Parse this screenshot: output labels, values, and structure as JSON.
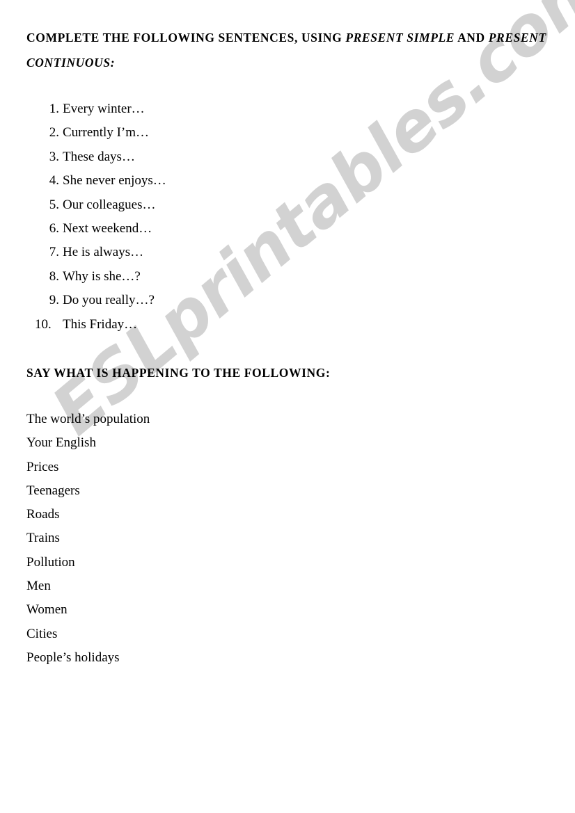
{
  "document": {
    "background_color": "#ffffff",
    "text_color": "#000000"
  },
  "headings": {
    "one": {
      "part_1": "COMPLETE THE FOLLOWING SENTENCES, USING ",
      "part_2_italic": "PRESENT SIMPLE",
      "part_3": " AND ",
      "part_4_italic": "PRESENT CONTINUOUS:"
    },
    "two": {
      "text": "SAY WHAT IS HAPPENING TO THE FOLLOWING:"
    }
  },
  "sentence_items": [
    {
      "number": "1.",
      "text": "Every winter…"
    },
    {
      "number": "2.",
      "text": "Currently I’m…"
    },
    {
      "number": "3.",
      "text": "These days…"
    },
    {
      "number": "4.",
      "text": "She never enjoys…"
    },
    {
      "number": "5.",
      "text": "Our colleagues…"
    },
    {
      "number": "6.",
      "text": "Next weekend…"
    },
    {
      "number": "7.",
      "text": "He is always…"
    },
    {
      "number": "8.",
      "text": "Why is she…?"
    },
    {
      "number": "9.",
      "text": "Do you really…?"
    },
    {
      "number": "10.",
      "text": "This Friday…"
    }
  ],
  "topic_items": [
    {
      "text": "The world’s population"
    },
    {
      "text": "Your English"
    },
    {
      "text": "Prices"
    },
    {
      "text": "Teenagers"
    },
    {
      "text": "Roads"
    },
    {
      "text": "Trains"
    },
    {
      "text": "Pollution"
    },
    {
      "text": "Men"
    },
    {
      "text": "Women"
    },
    {
      "text": "Cities"
    },
    {
      "text": "People’s holidays"
    }
  ],
  "watermark": {
    "text": "ESLprintables.com",
    "color": "#d2d2d2"
  }
}
